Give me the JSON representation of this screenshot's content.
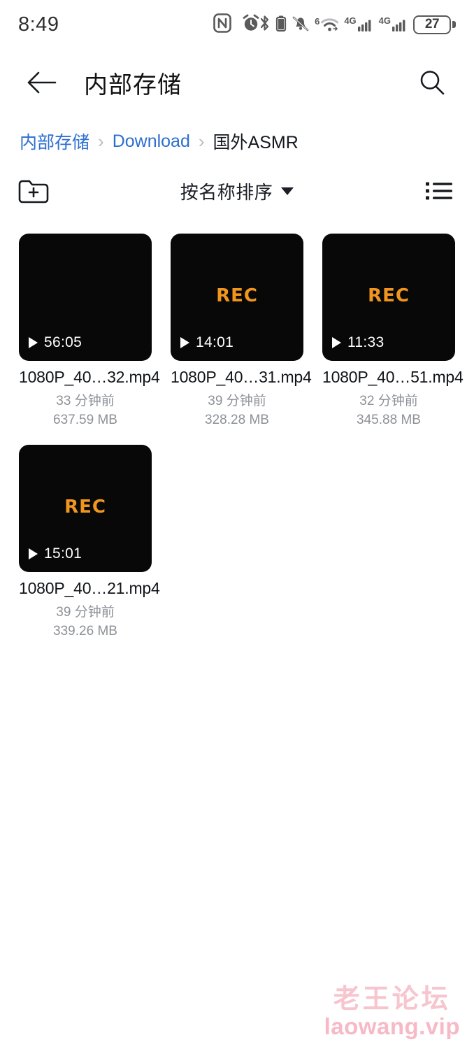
{
  "statusbar": {
    "time": "8:49",
    "battery_percent": "27",
    "signal_1_label": "4G",
    "signal_2_label": "4G",
    "wifi_gen_label": "6",
    "icons": [
      "nfc-icon",
      "alarm-icon",
      "bluetooth-icon",
      "bluetooth-battery-icon",
      "mute-bell-icon",
      "wifi-icon",
      "signal-4g-icon",
      "signal-4g-icon",
      "battery-icon"
    ]
  },
  "appbar": {
    "title": "内部存储",
    "back_icon": "back-arrow-icon",
    "search_icon": "search-icon"
  },
  "breadcrumb": {
    "separator": "›",
    "items": [
      {
        "label": "内部存储",
        "current": false
      },
      {
        "label": "Download",
        "current": false
      },
      {
        "label": "国外ASMR",
        "current": true
      }
    ]
  },
  "toolbar": {
    "new_folder_icon": "new-folder-icon",
    "sort_label": "按名称排序",
    "view_icon": "list-view-icon"
  },
  "files": [
    {
      "name": "1080P_40…32.mp4",
      "modified": "33 分钟前",
      "size": "637.59 MB",
      "duration": "56:05",
      "rec_badge": ""
    },
    {
      "name": "1080P_40…31.mp4",
      "modified": "39 分钟前",
      "size": "328.28 MB",
      "duration": "14:01",
      "rec_badge": "REC"
    },
    {
      "name": "1080P_40…51.mp4",
      "modified": "32 分钟前",
      "size": "345.88 MB",
      "duration": "11:33",
      "rec_badge": "REC"
    },
    {
      "name": "1080P_40…21.mp4",
      "modified": "39 分钟前",
      "size": "339.26 MB",
      "duration": "15:01",
      "rec_badge": "REC"
    }
  ],
  "watermark": {
    "line1": "老王论坛",
    "line2": "laowang.vip"
  },
  "colors": {
    "link": "#2c6fd1",
    "rec": "#f0961f",
    "thumb_bg": "#080808",
    "meta_text": "#8d9197",
    "watermark": "#f6c5ce"
  }
}
